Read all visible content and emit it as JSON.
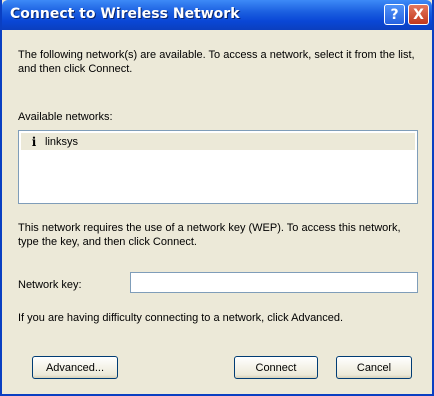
{
  "window": {
    "title": "Connect to Wireless Network",
    "help_glyph": "?",
    "close_glyph": "X"
  },
  "intro_text": "The following network(s) are available. To access a network, select it from the list, and then click Connect.",
  "available_networks_label": "Available networks:",
  "networks": [
    {
      "icon": "wireless-antenna-icon",
      "glyph": "i",
      "name": "linksys"
    }
  ],
  "wep_text": "This network requires the use of a network key (WEP). To access this network, type the key, and then click Connect.",
  "network_key": {
    "label": "Network key:",
    "value": ""
  },
  "advanced_hint": "If you are having difficulty connecting to a network, click Advanced.",
  "buttons": {
    "advanced": "Advanced...",
    "connect": "Connect",
    "cancel": "Cancel"
  }
}
